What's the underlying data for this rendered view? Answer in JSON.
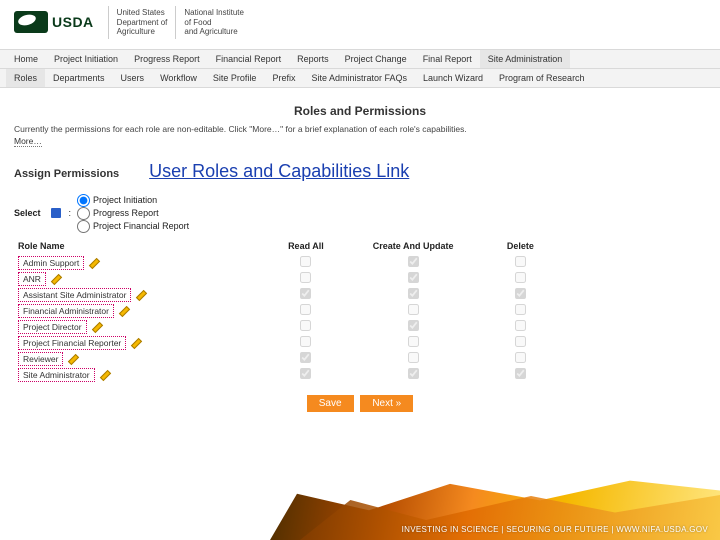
{
  "header": {
    "logo_text": "USDA",
    "dept1_line1": "United States",
    "dept1_line2": "Department of",
    "dept1_line3": "Agriculture",
    "dept2_line1": "National Institute",
    "dept2_line2": "of Food",
    "dept2_line3": "and Agriculture"
  },
  "nav_primary": [
    "Home",
    "Project Initiation",
    "Progress Report",
    "Financial Report",
    "Reports",
    "Project Change",
    "Final Report",
    "Site Administration"
  ],
  "nav_primary_active": 7,
  "nav_secondary": [
    "Roles",
    "Departments",
    "Users",
    "Workflow",
    "Site Profile",
    "Prefix",
    "Site Administrator FAQs",
    "Launch Wizard",
    "Program of Research"
  ],
  "nav_secondary_active": 0,
  "page_title": "Roles and Permissions",
  "intro_text": "Currently the permissions for each role are non-editable.  Click \"More…\" for a brief explanation of each role's capabilities.",
  "more_link": "More…",
  "assign_label": "Assign Permissions",
  "big_link": "User Roles and Capabilities Link",
  "select": {
    "prefix": "Select",
    "colon": ":",
    "options": [
      "Project Initiation",
      "Progress Report",
      "Project Financial Report"
    ],
    "selected": 0
  },
  "columns": {
    "name": "Role Name",
    "read": "Read All",
    "create": "Create And Update",
    "delete": "Delete"
  },
  "roles": [
    {
      "name": "Admin Support",
      "read": false,
      "create": true,
      "delete": false
    },
    {
      "name": "ANR",
      "read": false,
      "create": true,
      "delete": false
    },
    {
      "name": "Assistant Site Administrator",
      "read": true,
      "create": true,
      "delete": true
    },
    {
      "name": "Financial Administrator",
      "read": false,
      "create": false,
      "delete": false
    },
    {
      "name": "Project Director",
      "read": false,
      "create": true,
      "delete": false
    },
    {
      "name": "Project Financial Reporter",
      "read": false,
      "create": false,
      "delete": false
    },
    {
      "name": "Reviewer",
      "read": true,
      "create": false,
      "delete": false
    },
    {
      "name": "Site Administrator",
      "read": true,
      "create": true,
      "delete": true
    }
  ],
  "buttons": {
    "save": "Save",
    "next": "Next »"
  },
  "footer_tagline": "INVESTING IN SCIENCE | SECURING OUR FUTURE | WWW.NIFA.USDA.GOV"
}
